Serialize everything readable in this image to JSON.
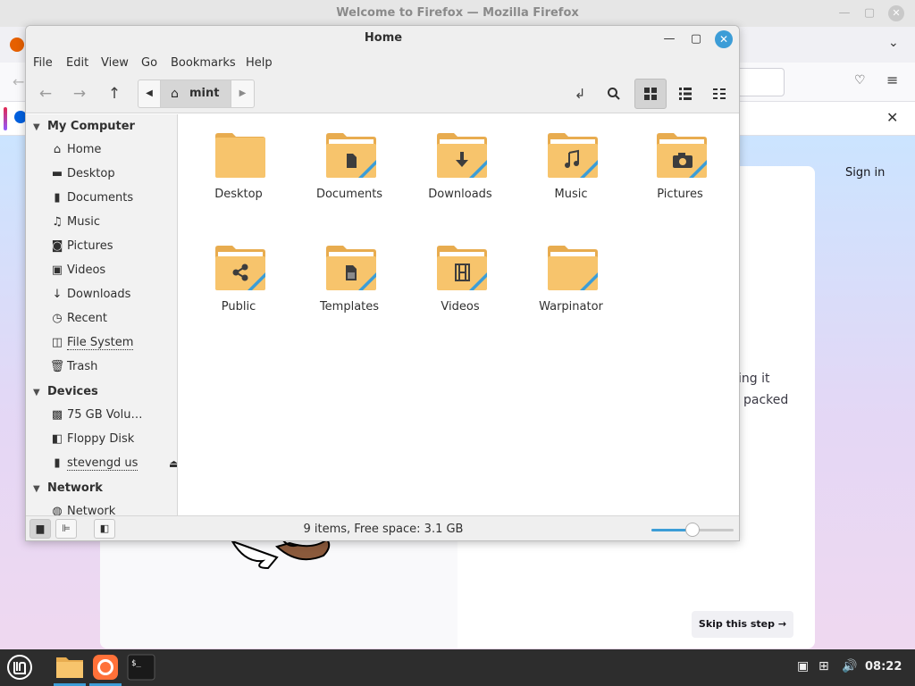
{
  "firefox": {
    "title": "Welcome to Firefox — Mozilla Firefox",
    "sign_in": "Sign in",
    "body_line1": "ing it",
    "body_line2": "packed",
    "skip_button": "Skip this step →"
  },
  "nemo": {
    "title": "Home",
    "menu": [
      "File",
      "Edit",
      "View",
      "Go",
      "Bookmarks",
      "Help"
    ],
    "breadcrumb": {
      "label": "mint"
    },
    "sidebar": {
      "sections": [
        {
          "title": "My Computer",
          "items": [
            {
              "label": "Home",
              "icon": "home-icon"
            },
            {
              "label": "Desktop",
              "icon": "desktop-icon"
            },
            {
              "label": "Documents",
              "icon": "documents-icon"
            },
            {
              "label": "Music",
              "icon": "music-icon"
            },
            {
              "label": "Pictures",
              "icon": "camera-icon"
            },
            {
              "label": "Videos",
              "icon": "film-icon"
            },
            {
              "label": "Downloads",
              "icon": "download-icon"
            },
            {
              "label": "Recent",
              "icon": "clock-icon"
            },
            {
              "label": "File System",
              "icon": "drive-icon"
            },
            {
              "label": "Trash",
              "icon": "trash-icon"
            }
          ]
        },
        {
          "title": "Devices",
          "items": [
            {
              "label": "75 GB Volu…",
              "icon": "disk-icon"
            },
            {
              "label": "Floppy Disk",
              "icon": "floppy-icon"
            },
            {
              "label": "stevengd us",
              "icon": "usb-icon"
            }
          ]
        },
        {
          "title": "Network",
          "items": [
            {
              "label": "Network",
              "icon": "network-icon"
            }
          ]
        }
      ]
    },
    "files": [
      {
        "label": "Desktop",
        "emblem": "none"
      },
      {
        "label": "Documents",
        "emblem": "document"
      },
      {
        "label": "Downloads",
        "emblem": "download"
      },
      {
        "label": "Music",
        "emblem": "music"
      },
      {
        "label": "Pictures",
        "emblem": "camera"
      },
      {
        "label": "Public",
        "emblem": "share"
      },
      {
        "label": "Templates",
        "emblem": "template"
      },
      {
        "label": "Videos",
        "emblem": "film"
      },
      {
        "label": "Warpinator",
        "emblem": "none"
      }
    ],
    "status": "9 items, Free space: 3.1 GB",
    "zoom_level": 0.5
  },
  "taskbar": {
    "clock": "08:22",
    "apps": [
      "mint-menu",
      "nemo-files",
      "firefox",
      "terminal"
    ]
  },
  "colors": {
    "accent": "#3c9dd7",
    "folder": "#f7c46c",
    "folder_tab": "#e8ac4f"
  }
}
